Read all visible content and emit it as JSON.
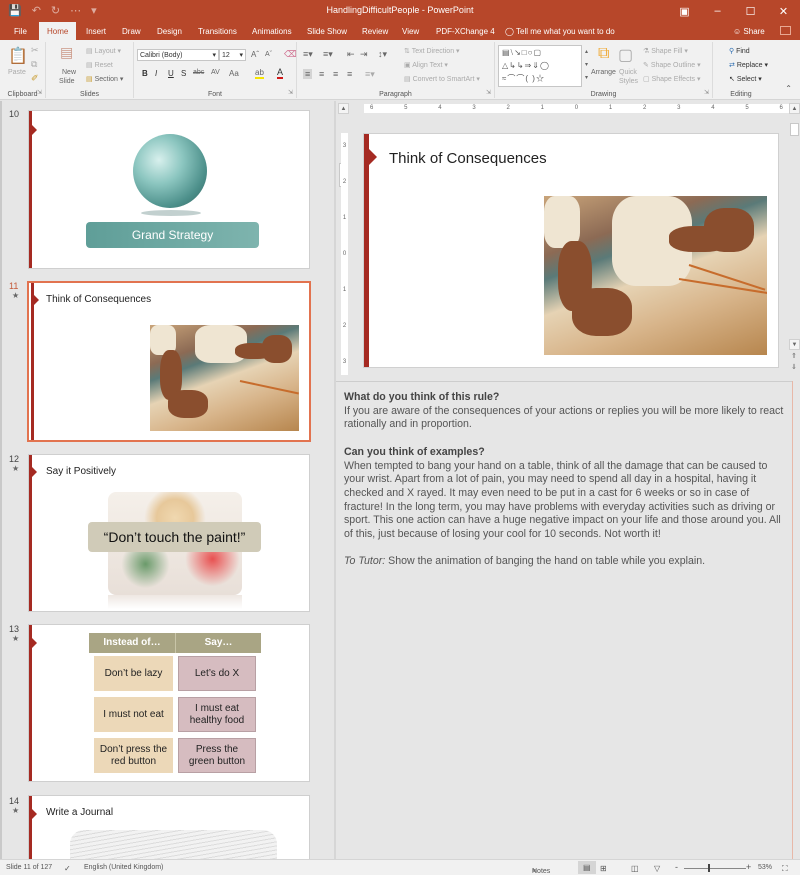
{
  "window": {
    "title": "HandlingDifficultPeople  -  PowerPoint",
    "controls": [
      "ribbon-display",
      "minimize",
      "maximize",
      "close"
    ]
  },
  "qat": {
    "save": "save-icon",
    "undo": "undo-icon",
    "redo": "redo-icon",
    "start": "start-from-beginning-icon",
    "customize": "customize-qat-icon"
  },
  "tabs": [
    {
      "label": "File"
    },
    {
      "label": "Home",
      "active": true
    },
    {
      "label": "Insert"
    },
    {
      "label": "Draw"
    },
    {
      "label": "Design"
    },
    {
      "label": "Transitions"
    },
    {
      "label": "Animations"
    },
    {
      "label": "Slide Show"
    },
    {
      "label": "Review"
    },
    {
      "label": "View"
    },
    {
      "label": "PDF-XChange 4"
    }
  ],
  "tell_me": "Tell me what you want to do",
  "share": "Share",
  "ribbon": {
    "clipboard": {
      "label": "Clipboard",
      "paste": "Paste"
    },
    "slides": {
      "label": "Slides",
      "new_slide": "New",
      "new_slide2": "Slide",
      "layout": "Layout",
      "reset": "Reset",
      "section": "Section"
    },
    "font": {
      "label": "Font",
      "font_name": "Calibri (Body)",
      "font_size": "12",
      "bold": "B",
      "italic": "I",
      "underline": "U",
      "shadow": "S",
      "strike": "abc",
      "spacing": "AV",
      "case": "Aa"
    },
    "paragraph": {
      "label": "Paragraph",
      "text_direction": "Text Direction",
      "align_text": "Align Text",
      "convert_smartart": "Convert to SmartArt"
    },
    "drawing": {
      "label": "Drawing",
      "arrange": "Arrange",
      "quick_styles": "Quick",
      "quick_styles2": "Styles",
      "shape_fill": "Shape Fill",
      "shape_outline": "Shape Outline",
      "shape_effects": "Shape Effects"
    },
    "editing": {
      "label": "Editing",
      "find": "Find",
      "replace": "Replace",
      "select": "Select"
    }
  },
  "thumbnails": [
    {
      "number": "10",
      "starred": false,
      "title": "",
      "button_text": "Grand Strategy"
    },
    {
      "number": "11",
      "starred": true,
      "title": "Think of Consequences",
      "selected": true
    },
    {
      "number": "12",
      "starred": true,
      "title": "Say it Positively",
      "callout": "“Don’t touch the paint!”"
    },
    {
      "number": "13",
      "starred": true,
      "title": "",
      "table": {
        "headers": [
          "Instead of…",
          "Say…"
        ],
        "rows": [
          [
            "Don’t be lazy",
            "Let’s do X"
          ],
          [
            "I must not eat",
            "I must eat healthy food"
          ],
          [
            "Don’t press the red button",
            "Press the green button"
          ]
        ]
      }
    },
    {
      "number": "14",
      "starred": true,
      "title": "Write a Journal"
    }
  ],
  "ruler": {
    "h_ticks": [
      "6",
      "5",
      "4",
      "3",
      "2",
      "1",
      "0",
      "1",
      "2",
      "3",
      "4",
      "5",
      "6"
    ],
    "v_ticks": [
      "3",
      "2",
      "1",
      "0",
      "1",
      "2",
      "3"
    ]
  },
  "slide": {
    "title": "Think of Consequences"
  },
  "notes": {
    "q1": "What do you think of this rule?",
    "a1": "If you are aware of the consequences of your actions or replies  you will be more likely to react rationally and in proportion.",
    "q2": "Can you think of examples?",
    "a2": "When tempted to bang your hand on a table, think of all the damage that can be caused to your wrist. Apart from a lot of pain, you may need to spend all day in a hospital, having it checked and X rayed. It may even need to be put in a cast for 6 weeks or so in case of fracture! In the long term, you may have problems with everyday activities such as driving or sport. This one action can have a huge negative impact on your life and those around you. All of this, just because of losing your cool for 10 seconds. Not worth it!",
    "tutor_label": "To Tutor:",
    "tutor_text": " Show the animation of banging the hand on table while you explain."
  },
  "status": {
    "slide_count": "Slide 11 of 127",
    "language": "English (United Kingdom)",
    "notes": "Notes",
    "zoom": "53%",
    "zoom_minus": "-",
    "zoom_plus": "+"
  },
  "colors": {
    "accent": "#b7472a",
    "slide_bar": "#a52a22",
    "selection": "#e2734f"
  }
}
